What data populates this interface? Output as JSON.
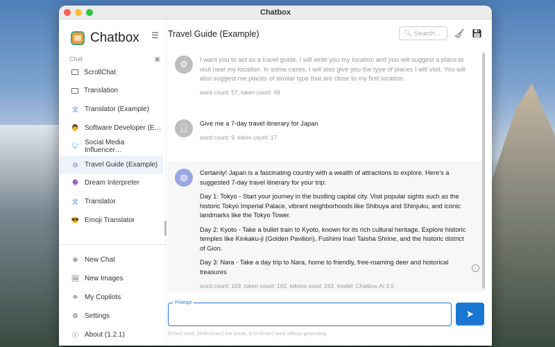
{
  "window": {
    "title": "Chatbox"
  },
  "sidebar": {
    "brand": "Chatbox",
    "section": "Chat",
    "chats": [
      {
        "label": "ScrollChat",
        "icon": "chat-bubble-icon"
      },
      {
        "label": "Translation",
        "icon": "chat-bubble-icon"
      },
      {
        "label": "Translator (Example)",
        "icon": "translator-avatar-icon"
      },
      {
        "label": "Software Developer (E…",
        "icon": "developer-avatar-icon"
      },
      {
        "label": "Social Media Influencer…",
        "icon": "twitter-icon"
      },
      {
        "label": "Travel Guide (Example)",
        "icon": "globe-avatar-icon"
      },
      {
        "label": "Dream Interpreter",
        "icon": "crystal-ball-icon"
      },
      {
        "label": "Translator",
        "icon": "translator-avatar-icon"
      },
      {
        "label": "Emoji Translator",
        "icon": "sunglasses-emoji-icon"
      }
    ],
    "actions": [
      {
        "label": "New Chat",
        "icon": "plus-circle-icon"
      },
      {
        "label": "New Images",
        "icon": "image-icon"
      },
      {
        "label": "My Copilots",
        "icon": "robot-icon"
      },
      {
        "label": "Settings",
        "icon": "gear-icon"
      },
      {
        "label": "About (1.2.1)",
        "icon": "info-icon"
      }
    ]
  },
  "header": {
    "title": "Travel Guide (Example)",
    "search_placeholder": "Search..."
  },
  "messages": [
    {
      "role": "system",
      "text": "I want you to act as a travel guide. I will write you my location and you will suggest a place to visit near my location. In some cases, I will also give you the type of places I will visit. You will also suggest me places of similar type that are close to my first location.",
      "meta": "word count: 57, token count: 69"
    },
    {
      "role": "user",
      "text": "Give me a 7-day travel itinerary for Japan",
      "meta": "word count: 9, token count: 17"
    },
    {
      "role": "assistant",
      "paragraphs": [
        "Certainly! Japan is a fascinating country with a wealth of attractions to explore. Here's a suggested 7-day travel itinerary for your trip:",
        "Day 1: Tokyo - Start your journey in the bustling capital city. Visit popular sights such as the historic Tokyo Imperial Palace, vibrant neighborhoods like Shibuya and Shinjuku, and iconic landmarks like the Tokyo Tower.",
        "Day 2: Kyoto - Take a bullet train to Kyoto, known for its rich cultural heritage. Explore historic temples like Kinkaku-ji (Golden Pavilion), Fushimi Inari Taisha Shrine, and the historic district of Gion.",
        "Day 3: Nara - Take a day trip to Nara, home to friendly, free-roaming deer and historical treasures"
      ],
      "meta": "word count: 109, token count: 162, tokens used: 243, model: Chatbox-AI 3.5"
    }
  ],
  "input": {
    "label": "Prompt",
    "value": "",
    "hint": "[Enter] send, [Shift+Enter] line break, [Ctrl+Enter] send without generating"
  }
}
